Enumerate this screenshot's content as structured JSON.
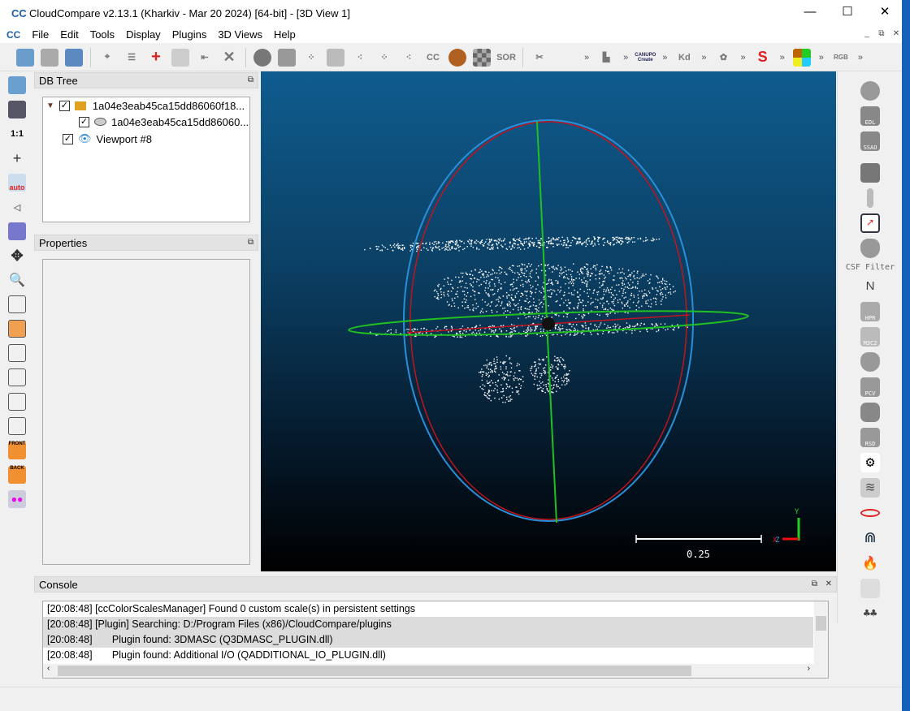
{
  "window": {
    "title": "CloudCompare v2.13.1 (Kharkiv - Mar 20 2024) [64-bit] - [3D View 1]",
    "logo": "CC",
    "minimize": "—",
    "maximize": "☐",
    "close": "✕"
  },
  "menu": {
    "items": [
      "File",
      "Edit",
      "Tools",
      "Display",
      "Plugins",
      "3D Views",
      "Help"
    ]
  },
  "toolbar": {
    "more": "»",
    "text_icons": {
      "cccc": "CC",
      "sor": "SOR",
      "canupo": "CANUPO",
      "canupo_create": "Create",
      "kd": "Kd",
      "rgb": "RGB"
    }
  },
  "left_toolbar": {
    "one_to_one": "1:1",
    "auto": "auto",
    "front": "FRONT",
    "back": "BACK"
  },
  "db_tree": {
    "title": "DB Tree",
    "items": [
      {
        "label": "1a04e3eab45ca15dd86060f18...",
        "checked": true,
        "icon": "folder-icon"
      },
      {
        "label": "1a04e3eab45ca15dd86060...",
        "checked": true,
        "icon": "cloud-icon"
      },
      {
        "label": "Viewport #8",
        "checked": true,
        "icon": "eye-icon"
      }
    ]
  },
  "properties": {
    "title": "Properties"
  },
  "view3d": {
    "scale_label": "0.25",
    "axis_y": "Y",
    "axis_x": "X",
    "axis_z": "Z",
    "colors": {
      "sphere_blue": "#2a8fd8",
      "sphere_red": "#c0141e",
      "axis_green": "#20c020"
    }
  },
  "right_toolbar": {
    "edl": "EDL",
    "ssao": "SSAO",
    "csf": "CSF Filter",
    "north": "N",
    "hpr": "HPR",
    "m3c2": "M3C2",
    "pcv": "PCV",
    "rsd": "RSD"
  },
  "console": {
    "title": "Console",
    "lines": [
      "[20:08:48] [ccColorScalesManager] Found 0 custom scale(s) in persistent settings",
      "[20:08:48] [Plugin] Searching: D:/Program Files (x86)/CloudCompare/plugins",
      "[20:08:48]       Plugin found: 3DMASC (Q3DMASC_PLUGIN.dll)",
      "[20:08:48]       Plugin found: Additional I/O (QADDITIONAL_IO_PLUGIN.dll)"
    ]
  }
}
